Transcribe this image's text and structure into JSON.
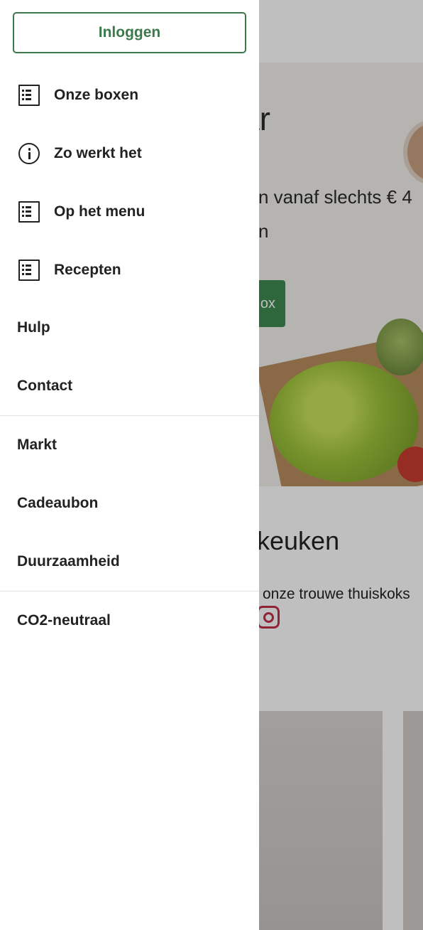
{
  "drawer": {
    "login_label": "Inloggen",
    "menu_primary": [
      {
        "label": "Onze boxen",
        "icon": "list-icon"
      },
      {
        "label": "Zo werkt het",
        "icon": "info-icon"
      },
      {
        "label": "Op het menu",
        "icon": "list-icon"
      },
      {
        "label": "Recepten",
        "icon": "list-icon"
      }
    ],
    "menu_secondary": [
      {
        "label": "Hulp"
      },
      {
        "label": "Contact"
      }
    ],
    "menu_tertiary": [
      {
        "label": "Markt"
      },
      {
        "label": "Cadeaubon"
      },
      {
        "label": "Duurzaamheid"
      }
    ],
    "menu_quaternary": [
      {
        "label": "CO2-neutraal"
      }
    ]
  },
  "background": {
    "hero_heading_fragment": "ar",
    "hero_sub_fragment": "n vanaf slechts € 4",
    "hero_sub2_fragment": "n",
    "cta_fragment": "ox",
    "kitchen_title_fragment": "keuken",
    "kitchen_sub_fragment": "onze trouwe thuiskoks"
  },
  "colors": {
    "brand_green": "#3a7a4a",
    "overlay": "rgba(0,0,0,0.25)"
  }
}
